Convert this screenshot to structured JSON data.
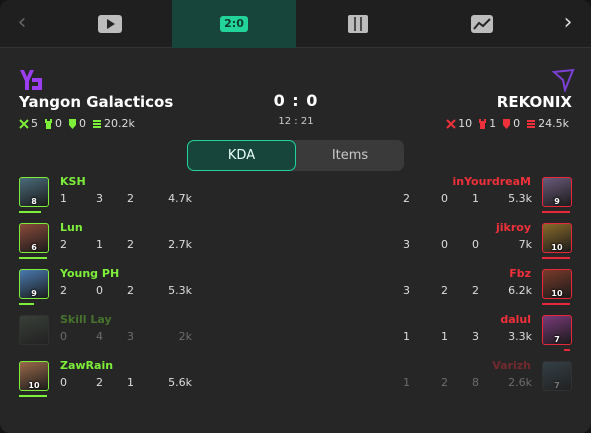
{
  "nav": {
    "left_arrow": "‹",
    "right_arrow": "›",
    "tabs": [
      {
        "icon": "play-icon"
      },
      {
        "icon": "score-icon",
        "label": "2:0",
        "active": true
      },
      {
        "icon": "map-icon"
      },
      {
        "icon": "chart-icon"
      }
    ]
  },
  "match": {
    "score": "0 : 0",
    "time": "12 : 21"
  },
  "radiant": {
    "name": "Yangon Galacticos",
    "logo": "yg-logo",
    "color": "#9b3df0",
    "stats": {
      "kills": "5",
      "towers": "0",
      "barracks": "0",
      "networth": "20.2k"
    }
  },
  "dire": {
    "name": "REKONIX",
    "logo": "rekonix-logo",
    "color": "#7b3fd6",
    "stats": {
      "kills": "10",
      "towers": "1",
      "barracks": "0",
      "networth": "24.5k"
    }
  },
  "toggle": {
    "kda": "KDA",
    "items": "Items"
  },
  "colors": {
    "accent": "#22d39a",
    "radiant_name": "#7dee3a",
    "dire_name": "#f0303a",
    "health": "#7dee3a",
    "dire_health": "#e8283a"
  },
  "radiant_players": [
    {
      "name": "KSH",
      "level": "8",
      "k": "1",
      "d": "3",
      "a": "2",
      "nw": "4.7k",
      "hp": 0.78,
      "alive": true
    },
    {
      "name": "Lun",
      "level": "6",
      "k": "2",
      "d": "1",
      "a": "2",
      "nw": "2.7k",
      "hp": 1.0,
      "alive": true
    },
    {
      "name": "Young PH",
      "level": "9",
      "k": "2",
      "d": "0",
      "a": "2",
      "nw": "5.3k",
      "hp": 0.55,
      "alive": true
    },
    {
      "name": "Skill Lay",
      "level": "",
      "k": "0",
      "d": "4",
      "a": "3",
      "nw": "2k",
      "hp": 0,
      "alive": false
    },
    {
      "name": "ZawRain",
      "level": "10",
      "k": "0",
      "d": "2",
      "a": "1",
      "nw": "5.6k",
      "hp": 1.0,
      "alive": true
    }
  ],
  "dire_players": [
    {
      "name": "inYourdreaM",
      "level": "9",
      "k": "2",
      "d": "0",
      "a": "1",
      "nw": "5.3k",
      "hp": 1.0,
      "alive": true
    },
    {
      "name": "jikroy",
      "level": "10",
      "k": "3",
      "d": "0",
      "a": "0",
      "nw": "7k",
      "hp": 1.0,
      "alive": true
    },
    {
      "name": "Fbz",
      "level": "10",
      "k": "3",
      "d": "2",
      "a": "2",
      "nw": "6.2k",
      "hp": 1.0,
      "alive": true
    },
    {
      "name": "dalul",
      "level": "7",
      "k": "1",
      "d": "1",
      "a": "3",
      "nw": "3.3k",
      "hp": 0.2,
      "alive": true
    },
    {
      "name": "Varizh",
      "level": "7",
      "k": "1",
      "d": "2",
      "a": "8",
      "nw": "2.6k",
      "hp": 0,
      "alive": false
    }
  ]
}
